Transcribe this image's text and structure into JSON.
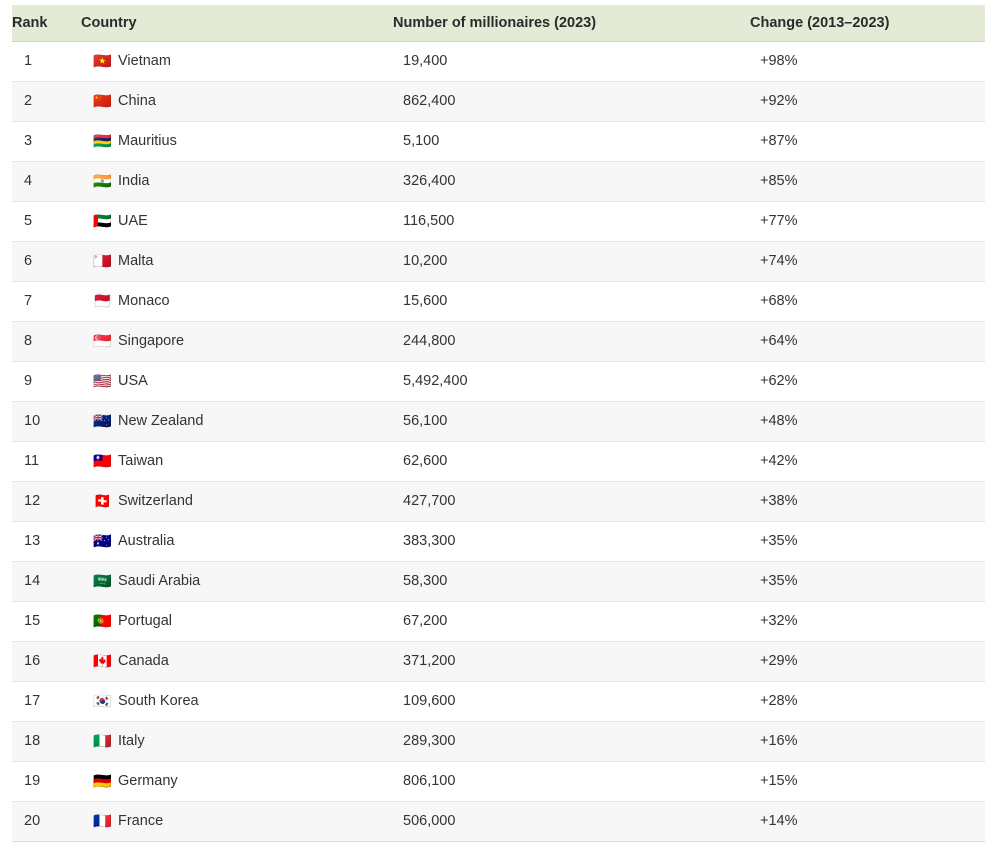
{
  "table": {
    "columns": [
      {
        "key": "rank",
        "label": "Rank"
      },
      {
        "key": "country",
        "label": "Country"
      },
      {
        "key": "number",
        "label": "Number of millionaires (2023)"
      },
      {
        "key": "change",
        "label": "Change (2013–2023)"
      }
    ],
    "header_background": "#e3ebd6",
    "row_alt_background": "#f7f7f7",
    "text_color": "#333333",
    "rows": [
      {
        "rank": "1",
        "flag": "🇻🇳",
        "flag_name": "flag-vietnam",
        "country": "Vietnam",
        "number": "19,400",
        "change": "+98%"
      },
      {
        "rank": "2",
        "flag": "🇨🇳",
        "flag_name": "flag-china",
        "country": "China",
        "number": "862,400",
        "change": "+92%"
      },
      {
        "rank": "3",
        "flag": "🇲🇺",
        "flag_name": "flag-mauritius",
        "country": "Mauritius",
        "number": "5,100",
        "change": "+87%"
      },
      {
        "rank": "4",
        "flag": "🇮🇳",
        "flag_name": "flag-india",
        "country": "India",
        "number": "326,400",
        "change": "+85%"
      },
      {
        "rank": "5",
        "flag": "🇦🇪",
        "flag_name": "flag-uae",
        "country": "UAE",
        "number": "116,500",
        "change": "+77%"
      },
      {
        "rank": "6",
        "flag": "🇲🇹",
        "flag_name": "flag-malta",
        "country": "Malta",
        "number": "10,200",
        "change": "+74%"
      },
      {
        "rank": "7",
        "flag": "🇲🇨",
        "flag_name": "flag-monaco",
        "country": "Monaco",
        "number": "15,600",
        "change": "+68%"
      },
      {
        "rank": "8",
        "flag": "🇸🇬",
        "flag_name": "flag-singapore",
        "country": "Singapore",
        "number": "244,800",
        "change": "+64%"
      },
      {
        "rank": "9",
        "flag": "🇺🇸",
        "flag_name": "flag-usa",
        "country": "USA",
        "number": "5,492,400",
        "change": "+62%"
      },
      {
        "rank": "10",
        "flag": "🇳🇿",
        "flag_name": "flag-new-zealand",
        "country": "New Zealand",
        "number": "56,100",
        "change": "+48%"
      },
      {
        "rank": "11",
        "flag": "🇹🇼",
        "flag_name": "flag-taiwan",
        "country": "Taiwan",
        "number": "62,600",
        "change": "+42%"
      },
      {
        "rank": "12",
        "flag": "🇨🇭",
        "flag_name": "flag-switzerland",
        "country": "Switzerland",
        "number": "427,700",
        "change": "+38%"
      },
      {
        "rank": "13",
        "flag": "🇦🇺",
        "flag_name": "flag-australia",
        "country": "Australia",
        "number": "383,300",
        "change": "+35%"
      },
      {
        "rank": "14",
        "flag": "🇸🇦",
        "flag_name": "flag-saudi-arabia",
        "country": "Saudi Arabia",
        "number": "58,300",
        "change": "+35%"
      },
      {
        "rank": "15",
        "flag": "🇵🇹",
        "flag_name": "flag-portugal",
        "country": "Portugal",
        "number": "67,200",
        "change": "+32%"
      },
      {
        "rank": "16",
        "flag": "🇨🇦",
        "flag_name": "flag-canada",
        "country": "Canada",
        "number": "371,200",
        "change": "+29%"
      },
      {
        "rank": "17",
        "flag": "🇰🇷",
        "flag_name": "flag-south-korea",
        "country": "South Korea",
        "number": "109,600",
        "change": "+28%"
      },
      {
        "rank": "18",
        "flag": "🇮🇹",
        "flag_name": "flag-italy",
        "country": "Italy",
        "number": "289,300",
        "change": "+16%"
      },
      {
        "rank": "19",
        "flag": "🇩🇪",
        "flag_name": "flag-germany",
        "country": "Germany",
        "number": "806,100",
        "change": "+15%"
      },
      {
        "rank": "20",
        "flag": "🇫🇷",
        "flag_name": "flag-france",
        "country": "France",
        "number": "506,000",
        "change": "+14%"
      }
    ]
  }
}
